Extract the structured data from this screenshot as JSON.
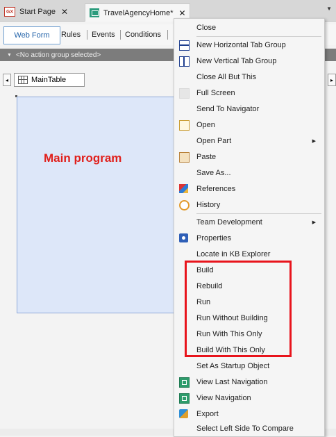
{
  "tabs": [
    {
      "label": "Start Page",
      "icon": "gx-icon",
      "badge": "GX"
    },
    {
      "label": "TravelAgencyHome",
      "icon": "transaction-icon"
    }
  ],
  "designer_tabs": [
    "Web Form",
    "Rules",
    "Events",
    "Conditions"
  ],
  "action_group": "<No action group selected>",
  "control_name": "MainTable",
  "canvas_text": "Main program",
  "menu": {
    "items": [
      {
        "label": "Close",
        "icon": "none"
      },
      {
        "label": "New Horizontal Tab Group",
        "icon": "horizontal-split-icon"
      },
      {
        "label": "New Vertical Tab Group",
        "icon": "vertical-split-icon"
      },
      {
        "label": "Close All But This",
        "icon": "none"
      },
      {
        "label": "Full Screen",
        "icon": "full-screen-icon"
      },
      {
        "label": "Send To Navigator",
        "icon": "none"
      },
      {
        "label": "Open",
        "icon": "open-icon"
      },
      {
        "label": "Open Part",
        "icon": "none",
        "submenu": true
      },
      {
        "label": "Paste",
        "icon": "paste-icon"
      },
      {
        "label": "Save As...",
        "icon": "none"
      },
      {
        "label": "References",
        "icon": "references-icon"
      },
      {
        "label": "History",
        "icon": "history-icon"
      },
      {
        "label": "Team Development",
        "icon": "none",
        "submenu": true
      },
      {
        "label": "Properties",
        "icon": "properties-icon"
      },
      {
        "label": "Locate in KB Explorer",
        "icon": "none"
      },
      {
        "label": "Build",
        "icon": "none"
      },
      {
        "label": "Rebuild",
        "icon": "none"
      },
      {
        "label": "Run",
        "icon": "none"
      },
      {
        "label": "Run Without Building",
        "icon": "none"
      },
      {
        "label": "Run With This Only",
        "icon": "none"
      },
      {
        "label": "Build With This Only",
        "icon": "none"
      },
      {
        "label": "Set As Startup Object",
        "icon": "none"
      },
      {
        "label": "View Last Navigation",
        "icon": "navigation-icon"
      },
      {
        "label": "View Navigation",
        "icon": "navigation-icon"
      },
      {
        "label": "Export",
        "icon": "export-icon"
      },
      {
        "label": "Select Left Side To Compare",
        "icon": "none"
      }
    ]
  },
  "colors": {
    "highlight": "#e8141c",
    "accent": "#2061a8",
    "canvas": "#dde7f9",
    "canvas_text": "#e0201c"
  }
}
